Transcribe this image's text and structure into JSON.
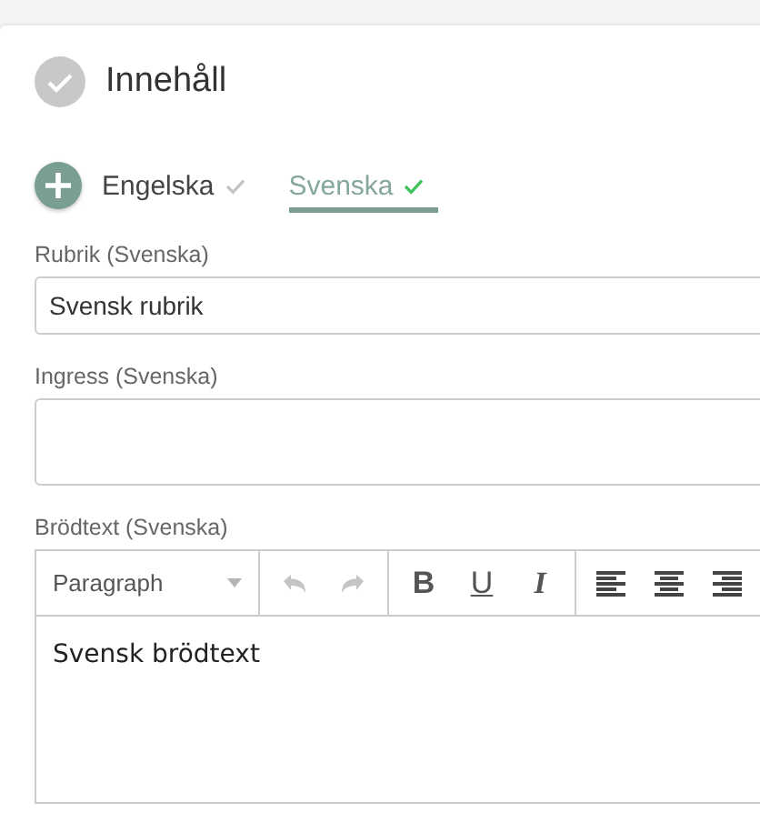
{
  "section": {
    "title": "Innehåll",
    "complete": true
  },
  "tabs": [
    {
      "label": "Engelska",
      "selected": false
    },
    {
      "label": "Svenska",
      "selected": true
    }
  ],
  "fields": [
    {
      "kind": "input",
      "label": "Rubrik (Svenska)",
      "value": "Svensk rubrik"
    },
    {
      "kind": "textarea",
      "label": "Ingress (Svenska)"
    }
  ],
  "editor": {
    "label": "Brödtext (Svenska)",
    "block_format": "Paragraph",
    "toolbar": [
      {
        "kind": "undo",
        "disabled": true
      },
      {
        "kind": "redo",
        "disabled": true
      },
      {
        "kind": "bold",
        "label": "B"
      },
      {
        "kind": "underline",
        "label": "U"
      },
      {
        "kind": "italic",
        "label": "I"
      },
      {
        "kind": "align-left"
      },
      {
        "kind": "align-center"
      },
      {
        "kind": "align-right"
      }
    ],
    "content": "Svensk brödtext"
  }
}
